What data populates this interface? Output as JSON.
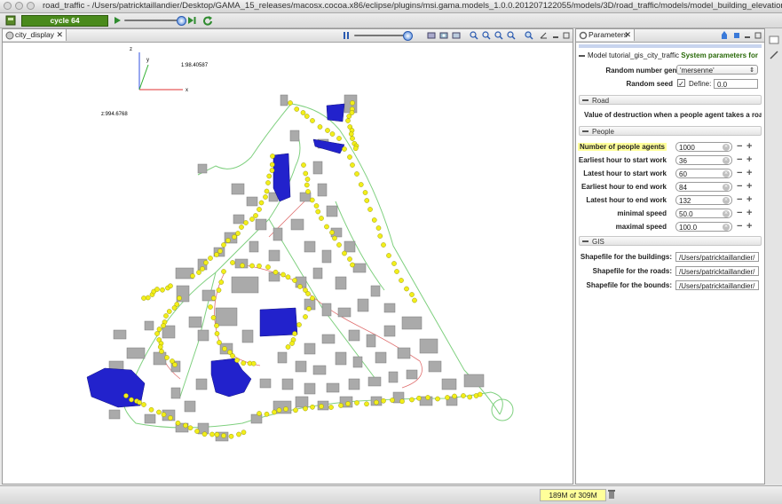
{
  "window": {
    "title": "road_traffic - /Users/patricktaillandier/Desktop/GAMA_15_releases/macosx.cocoa.x86/eclipse/plugins/msi.gama.models_1.0.0.201207122055/models/3D/road_traffic/models/model_building_elevation.gaml"
  },
  "toolbar": {
    "cycle_label": "cycle 64",
    "speed_slider_value": 0.95
  },
  "left_view": {
    "tab_label": "city_display",
    "zoom_slider_value": 0.95,
    "overlay": {
      "axis_x": "x",
      "axis_y": "y",
      "axis_z": "z",
      "coord_1": "1:98.40587",
      "coord_2": "z:994.6768"
    }
  },
  "right_view": {
    "tab_label": "Parameters",
    "model_line": {
      "label": "Model tutorial_gis_city_traffic",
      "link": "System parameters for"
    },
    "system_params": [
      {
        "label": "Random number generator",
        "value": "'mersenne'"
      },
      {
        "label": "Random seed",
        "checkbox_label": "Define:",
        "value": "0.0"
      }
    ],
    "road_section": {
      "title": "Road",
      "line": "Value of destruction when a people agent takes a road"
    },
    "people_section": {
      "title": "People",
      "params": [
        {
          "label": "Number of people agents",
          "value": "1000"
        },
        {
          "label": "Earliest hour to start work",
          "value": "36"
        },
        {
          "label": "Latest hour to start work",
          "value": "60"
        },
        {
          "label": "Earliest hour to end work",
          "value": "84"
        },
        {
          "label": "Latest hour to end work",
          "value": "132"
        },
        {
          "label": "minimal speed",
          "value": "50.0"
        },
        {
          "label": "maximal speed",
          "value": "100.0"
        }
      ]
    },
    "gis_section": {
      "title": "GIS",
      "params": [
        {
          "label": "Shapefile for the buildings:",
          "value": "/Users/patricktaillandier/"
        },
        {
          "label": "Shapefile for the roads:",
          "value": "/Users/patricktaillandier/"
        },
        {
          "label": "Shapefile for the bounds:",
          "value": "/Users/patricktaillandier/"
        }
      ]
    }
  },
  "status": {
    "memory": "189M of 309M"
  },
  "colors": {
    "cycle_green": "#4a8a1c",
    "building_grey": "#a8a8a8",
    "people_yellow": "#f2ee1a",
    "people_blue": "#2222cc",
    "road_green": "#7fd07f",
    "road_red": "#e07070",
    "highlight_yellow": "#ffff9a"
  }
}
